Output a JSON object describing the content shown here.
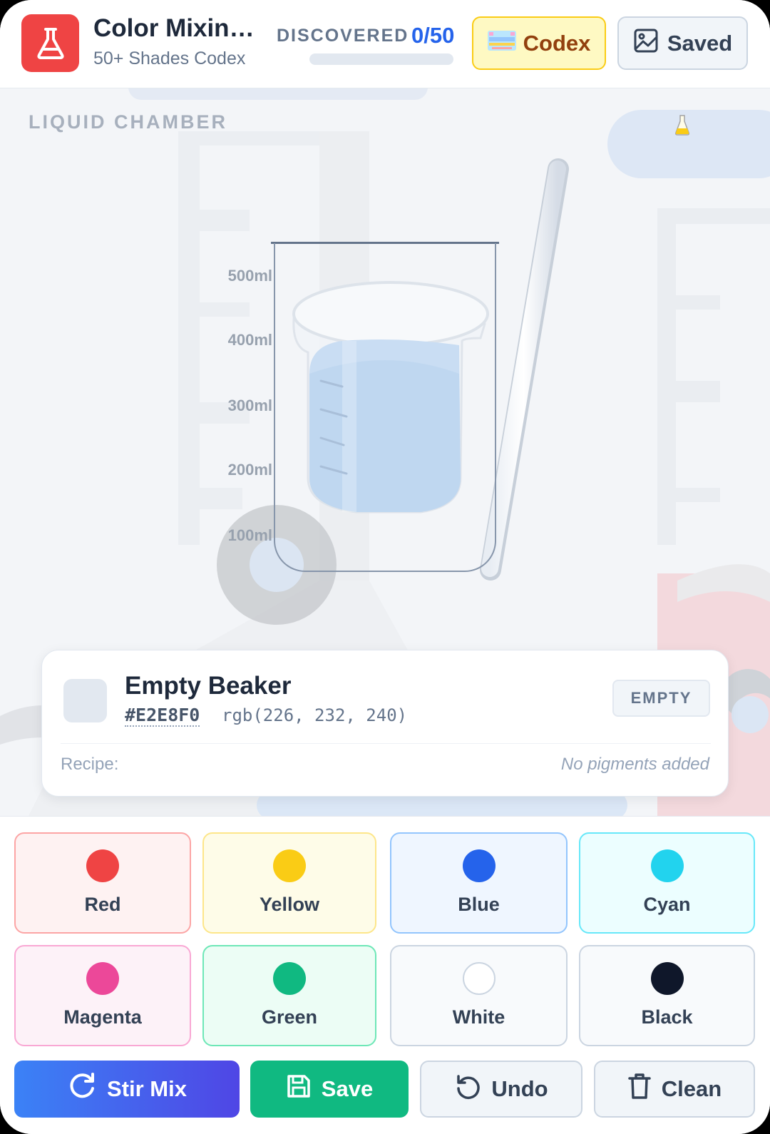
{
  "header": {
    "title": "Color Mixing Lab",
    "subtitle": "50+ Shades Codex",
    "discovered_label": "DISCOVERED",
    "discovered_count": "0/50",
    "discovered_fraction": 0,
    "codex_label": "Codex",
    "saved_label": "Saved"
  },
  "chamber": {
    "label": "LIQUID CHAMBER",
    "ticks": [
      "500ml",
      "400ml",
      "300ml",
      "200ml",
      "100ml"
    ]
  },
  "mix": {
    "name": "Empty Beaker",
    "hex": "#E2E8F0",
    "rgb": "rgb(226, 232, 240)",
    "status": "EMPTY",
    "recipe_label": "Recipe:",
    "recipe_value": "No pigments added"
  },
  "pigments": [
    {
      "label": "Red",
      "color": "#ef4444",
      "bg": "#fef2f2",
      "border": "#fca5a5"
    },
    {
      "label": "Yellow",
      "color": "#facc15",
      "bg": "#fefce8",
      "border": "#fde68a"
    },
    {
      "label": "Blue",
      "color": "#2563eb",
      "bg": "#eff6ff",
      "border": "#93c5fd"
    },
    {
      "label": "Cyan",
      "color": "#22d3ee",
      "bg": "#ecfeff",
      "border": "#67e8f9"
    },
    {
      "label": "Magenta",
      "color": "#ec4899",
      "bg": "#fdf2f8",
      "border": "#f9a8d4"
    },
    {
      "label": "Green",
      "color": "#10b981",
      "bg": "#ecfdf5",
      "border": "#6ee7b7"
    },
    {
      "label": "White",
      "color": "#ffffff",
      "bg": "#f8fafc",
      "border": "#cbd5e1"
    },
    {
      "label": "Black",
      "color": "#0f172a",
      "bg": "#f8fafc",
      "border": "#cbd5e1"
    }
  ],
  "actions": {
    "stir_label": "Stir Mix",
    "save_label": "Save",
    "undo_label": "Undo",
    "clean_label": "Clean"
  },
  "colors": {
    "accent_red": "#ef4444",
    "accent_blue": "#2563eb",
    "stir_gradient": [
      "#3b82f6",
      "#4f46e5"
    ],
    "save_green": "#10b981"
  }
}
